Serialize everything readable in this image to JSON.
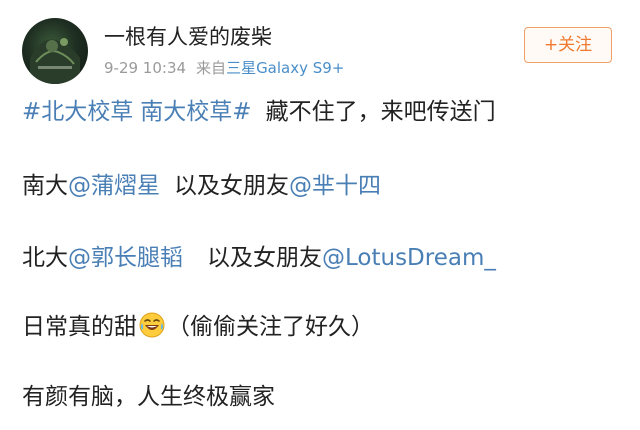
{
  "user": {
    "name": "一根有人爱的废柴",
    "time": "9-29 10:34",
    "source_prefix": "来自",
    "source_device": "三星Galaxy S9+"
  },
  "follow_button": {
    "label": "+关注"
  },
  "post": {
    "hashtags": [
      "#北大校草",
      "南大校草#"
    ],
    "line1_text": "藏不住了，来吧传送门",
    "line2_prefix": "南大",
    "line2_mention1": "@蒲熠星",
    "line2_mid": "以及女朋友",
    "line2_mention2": "@芈十四",
    "line3_prefix": "北大",
    "line3_mention1": "@郭长腿韬",
    "line3_mid": "以及女朋友",
    "line3_mention2": "@LotusDream_",
    "line4_text_a": "日常真的甜",
    "line4_emoji": "laughing-tears-emoji",
    "line4_text_b": "（偷偷关注了好久）",
    "line5_text": "有颜有脑，人生终极赢家"
  },
  "colors": {
    "link": "#4a7fb5",
    "follow_accent": "#ef7a2f",
    "meta_gray": "#9a9a9a",
    "device_blue": "#4a8ec9"
  }
}
